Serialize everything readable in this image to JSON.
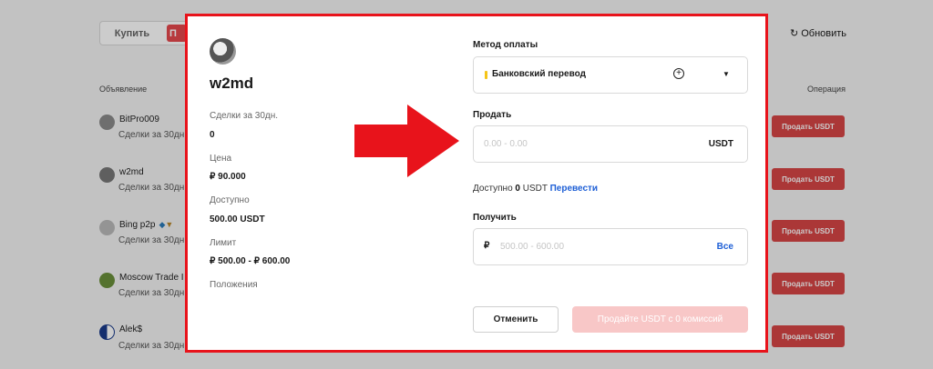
{
  "background": {
    "tabs": {
      "buy": "Купить",
      "sell": "П"
    },
    "refresh_label": "Обновить",
    "columns": {
      "ad": "Объявление",
      "operation": "Операция"
    },
    "rows": [
      {
        "name": "BitPro009",
        "sub": "Сделки за 30дн",
        "button": "Продать USDT"
      },
      {
        "name": "w2md",
        "sub": "Сделки за 30дн",
        "button": "Продать USDT"
      },
      {
        "name": "Bing p2p",
        "sub": "Сделки за 30дн",
        "button": "Продать USDT"
      },
      {
        "name": "Moscow Trade I",
        "sub": "Сделки за 30дн",
        "button": "Продать USDT"
      },
      {
        "name": "Alek$",
        "sub": "Сделки за 30дн",
        "button": "Продать USDT"
      }
    ]
  },
  "modal": {
    "name": "w2md",
    "deals_label": "Сделки за 30дн.",
    "deals_value": "0",
    "price_label": "Цена",
    "price_value": "₽ 90.000",
    "available_label": "Доступно",
    "available_value": "500.00 USDT",
    "limit_label": "Лимит",
    "limit_value": "₽ 500.00 - ₽ 600.00",
    "terms_label": "Положения",
    "payment_method_label": "Метод оплаты",
    "payment_method_value": "Банковский перевод",
    "sell_label": "Продать",
    "sell_placeholder": "0.00 - 0.00",
    "sell_currency": "USDT",
    "available_line": {
      "prefix": "Доступно",
      "amount": "0",
      "unit": "USDT",
      "transfer": "Перевести"
    },
    "receive_label": "Получить",
    "receive_symbol": "₽",
    "receive_placeholder": "500.00 - 600.00",
    "receive_all": "Все",
    "cancel": "Отменить",
    "submit": "Продайте USDT с 0 комиссий"
  },
  "colors": {
    "accent_red": "#e5484d",
    "link_blue": "#1e5fd6",
    "highlight_red": "#e8131b"
  }
}
